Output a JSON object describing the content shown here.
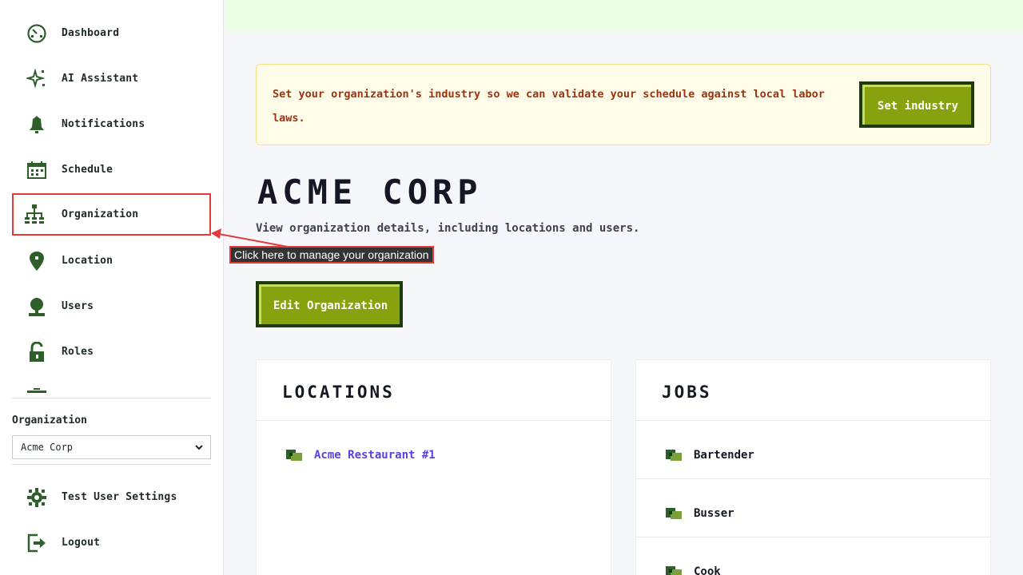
{
  "sidebar": {
    "items": [
      {
        "label": "Dashboard",
        "icon": "dashboard-icon"
      },
      {
        "label": "AI Assistant",
        "icon": "sparkle-icon"
      },
      {
        "label": "Notifications",
        "icon": "bell-icon"
      },
      {
        "label": "Schedule",
        "icon": "calendar-icon"
      },
      {
        "label": "Organization",
        "icon": "org-chart-icon"
      },
      {
        "label": "Location",
        "icon": "map-pin-icon"
      },
      {
        "label": "Users",
        "icon": "user-icon"
      },
      {
        "label": "Roles",
        "icon": "lock-icon"
      }
    ],
    "org_label": "Organization",
    "org_selected": "Acme Corp",
    "bottom": [
      {
        "label": "Test User Settings",
        "icon": "gear-icon"
      },
      {
        "label": "Logout",
        "icon": "logout-icon"
      }
    ]
  },
  "alert": {
    "text": "Set your organization's industry so we can validate your schedule against local labor laws.",
    "button": "Set industry"
  },
  "header": {
    "title": "ACME CORP",
    "description": "View organization details, including locations and users."
  },
  "tooltip": "Click here to manage your organization",
  "edit_button": "Edit Organization",
  "locations": {
    "title": "LOCATIONS",
    "items": [
      "Acme Restaurant #1"
    ]
  },
  "jobs": {
    "title": "JOBS",
    "items": [
      "Bartender",
      "Busser",
      "Cook"
    ]
  },
  "colors": {
    "accent": "#86a20e",
    "dark_green": "#1e3a0c",
    "icon_green": "#2e5e2a",
    "alert_text": "#9a3412",
    "link": "#5b3fe0",
    "highlight": "#e33a3a"
  }
}
